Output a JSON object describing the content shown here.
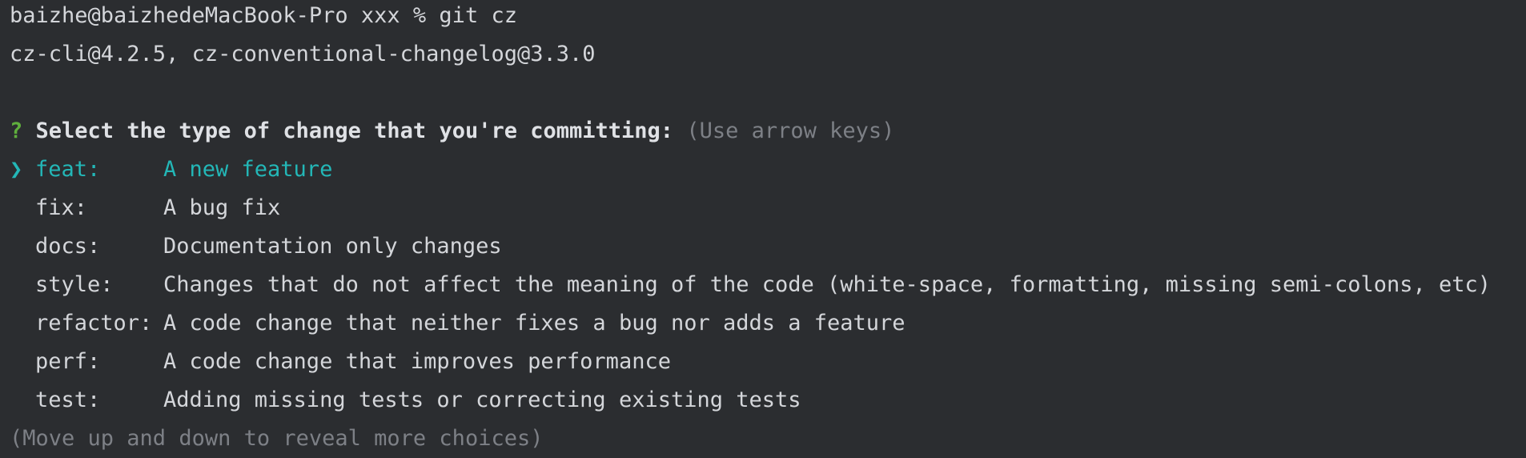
{
  "terminal": {
    "command_line": "baizhe@baizhedeMacBook-Pro xxx % git cz",
    "version_line": "cz-cli@4.2.5, cz-conventional-changelog@3.3.0",
    "prompt": {
      "qmark": "?",
      "question": "Select the type of change that you're committing:",
      "hint": "(Use arrow keys)"
    },
    "pointer": "❯",
    "choices": [
      {
        "name": "feat:",
        "description": "A new feature",
        "selected": true
      },
      {
        "name": "fix:",
        "description": "A bug fix",
        "selected": false
      },
      {
        "name": "docs:",
        "description": "Documentation only changes",
        "selected": false
      },
      {
        "name": "style:",
        "description": "Changes that do not affect the meaning of the code (white-space, formatting, missing semi-colons, etc)",
        "selected": false
      },
      {
        "name": "refactor:",
        "description": "A code change that neither fixes a bug nor adds a feature",
        "selected": false
      },
      {
        "name": "perf:",
        "description": "A code change that improves performance",
        "selected": false
      },
      {
        "name": "test:",
        "description": "Adding missing tests or correcting existing tests",
        "selected": false
      }
    ],
    "footer": "(Move up and down to reveal more choices)"
  },
  "colors": {
    "background": "#2b2d30",
    "text": "#d4d6da",
    "accent": "#23b7b7",
    "qmark": "#5fae3d",
    "muted": "#7d8086"
  }
}
